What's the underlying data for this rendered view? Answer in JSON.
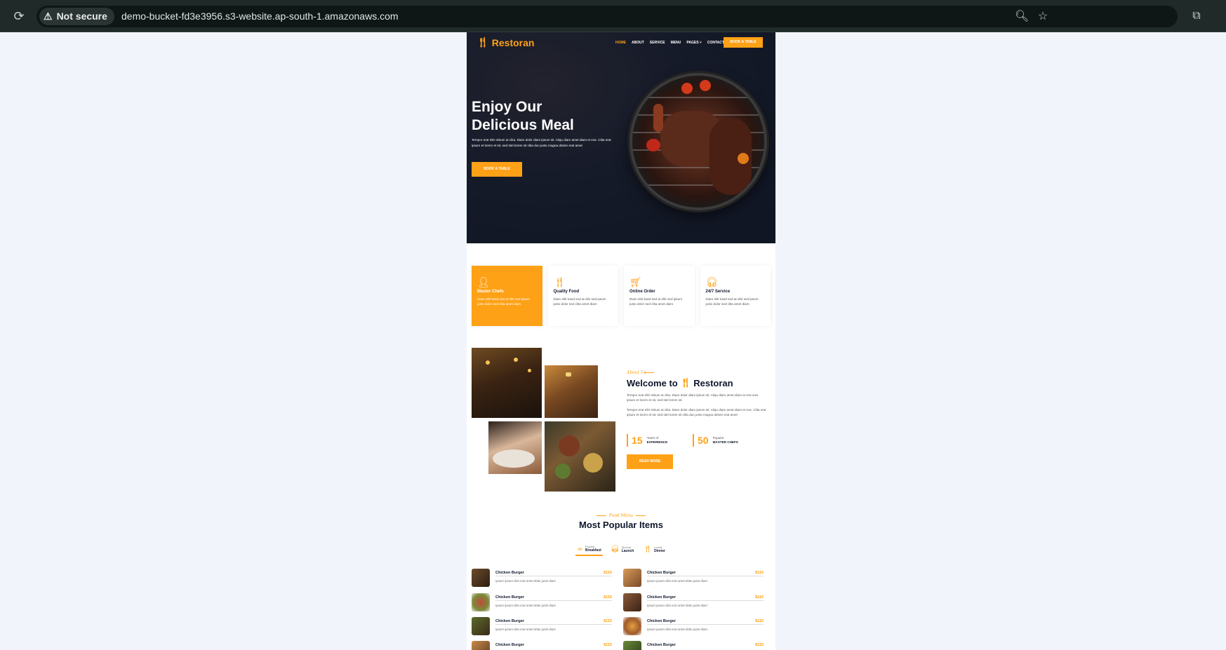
{
  "browser": {
    "security_label": "Not secure",
    "url": "demo-bucket-fd3e3956.s3-website.ap-south-1.amazonaws.com",
    "icons": [
      "reload-icon",
      "warning-icon",
      "zoom-icon",
      "star-icon",
      "extensions-icon"
    ]
  },
  "site": {
    "brand": "Restoran",
    "nav": [
      {
        "label": "HOME",
        "active": true
      },
      {
        "label": "ABOUT",
        "active": false
      },
      {
        "label": "SERVICE",
        "active": false
      },
      {
        "label": "MENU",
        "active": false
      },
      {
        "label": "PAGES ˅",
        "active": false
      },
      {
        "label": "CONTACT",
        "active": false
      }
    ],
    "nav_button": "BOOK A TABLE",
    "accent_color": "#FEA116",
    "dark_color": "#0F172B"
  },
  "hero": {
    "title_line1": "Enjoy Our",
    "title_line2": "Delicious Meal",
    "text": "Tempor erat elitr rebum at clita. Diam dolor diam ipsum sit. Aliqu diam amet diam et eos. Clita erat ipsum et lorem et sit, sed stet lorem sit clita duo justo magna dolore erat amet",
    "button": "BOOK A TABLE"
  },
  "services": [
    {
      "icon": "chef-icon",
      "title": "Master Chefs",
      "text": "Diam elitr kasd sed at elitr sed ipsum justo dolor sed clita amet diam",
      "active": true
    },
    {
      "icon": "utensils-icon",
      "title": "Quality Food",
      "text": "Diam elitr kasd sed at elitr sed ipsum justo dolor sed clita amet diam",
      "active": false
    },
    {
      "icon": "cart-icon",
      "title": "Online Order",
      "text": "Diam elitr kasd sed at elitr sed ipsum justo dolor sed clita amet diam",
      "active": false
    },
    {
      "icon": "headset-icon",
      "title": "24/7 Service",
      "text": "Diam elitr kasd sed at elitr sed ipsum justo dolor sed clita amet diam",
      "active": false
    }
  ],
  "about": {
    "tag": "About Us",
    "title_prefix": "Welcome to",
    "title_brand": "Restoran",
    "paragraph1": "Tempor erat elitr rebum at clita. Diam dolor diam ipsum sit. Aliqu diam amet diam et eos erat ipsum et lorem et sit, sed stet lorem sit.",
    "paragraph2": "Tempor erat elitr rebum at clita. Diam dolor diam ipsum sit. Aliqu diam amet diam et eos. Clita erat ipsum et lorem et sit, sed stet lorem sit clita duo justo magna dolore erat amet",
    "stats": [
      {
        "number": "15",
        "small": "Years of",
        "big": "EXPERIENCE"
      },
      {
        "number": "50",
        "small": "Popular",
        "big": "MASTER CHEFS"
      }
    ],
    "button": "READ MORE"
  },
  "menu": {
    "tag": "Food Menu",
    "title": "Most Popular Items",
    "tabs": [
      {
        "icon": "coffee-icon",
        "small": "Popular",
        "big": "Breakfast",
        "active": true
      },
      {
        "icon": "burger-icon",
        "small": "Special",
        "big": "Launch",
        "active": false
      },
      {
        "icon": "utensils-icon",
        "small": "Lovely",
        "big": "Dinner",
        "active": false
      }
    ],
    "items_left": [
      {
        "name": "Chicken Burger",
        "price": "$115",
        "desc": "Ipsum ipsum clita erat amet dolor justo diam"
      },
      {
        "name": "Chicken Burger",
        "price": "$115",
        "desc": "Ipsum ipsum clita erat amet dolor justo diam"
      },
      {
        "name": "Chicken Burger",
        "price": "$115",
        "desc": "Ipsum ipsum clita erat amet dolor justo diam"
      },
      {
        "name": "Chicken Burger",
        "price": "$115",
        "desc": ""
      }
    ],
    "items_right": [
      {
        "name": "Chicken Burger",
        "price": "$115",
        "desc": "Ipsum ipsum clita erat amet dolor justo diam"
      },
      {
        "name": "Chicken Burger",
        "price": "$115",
        "desc": "Ipsum ipsum clita erat amet dolor justo diam"
      },
      {
        "name": "Chicken Burger",
        "price": "$115",
        "desc": "Ipsum ipsum clita erat amet dolor justo diam"
      },
      {
        "name": "Chicken Burger",
        "price": "$115",
        "desc": ""
      }
    ]
  }
}
